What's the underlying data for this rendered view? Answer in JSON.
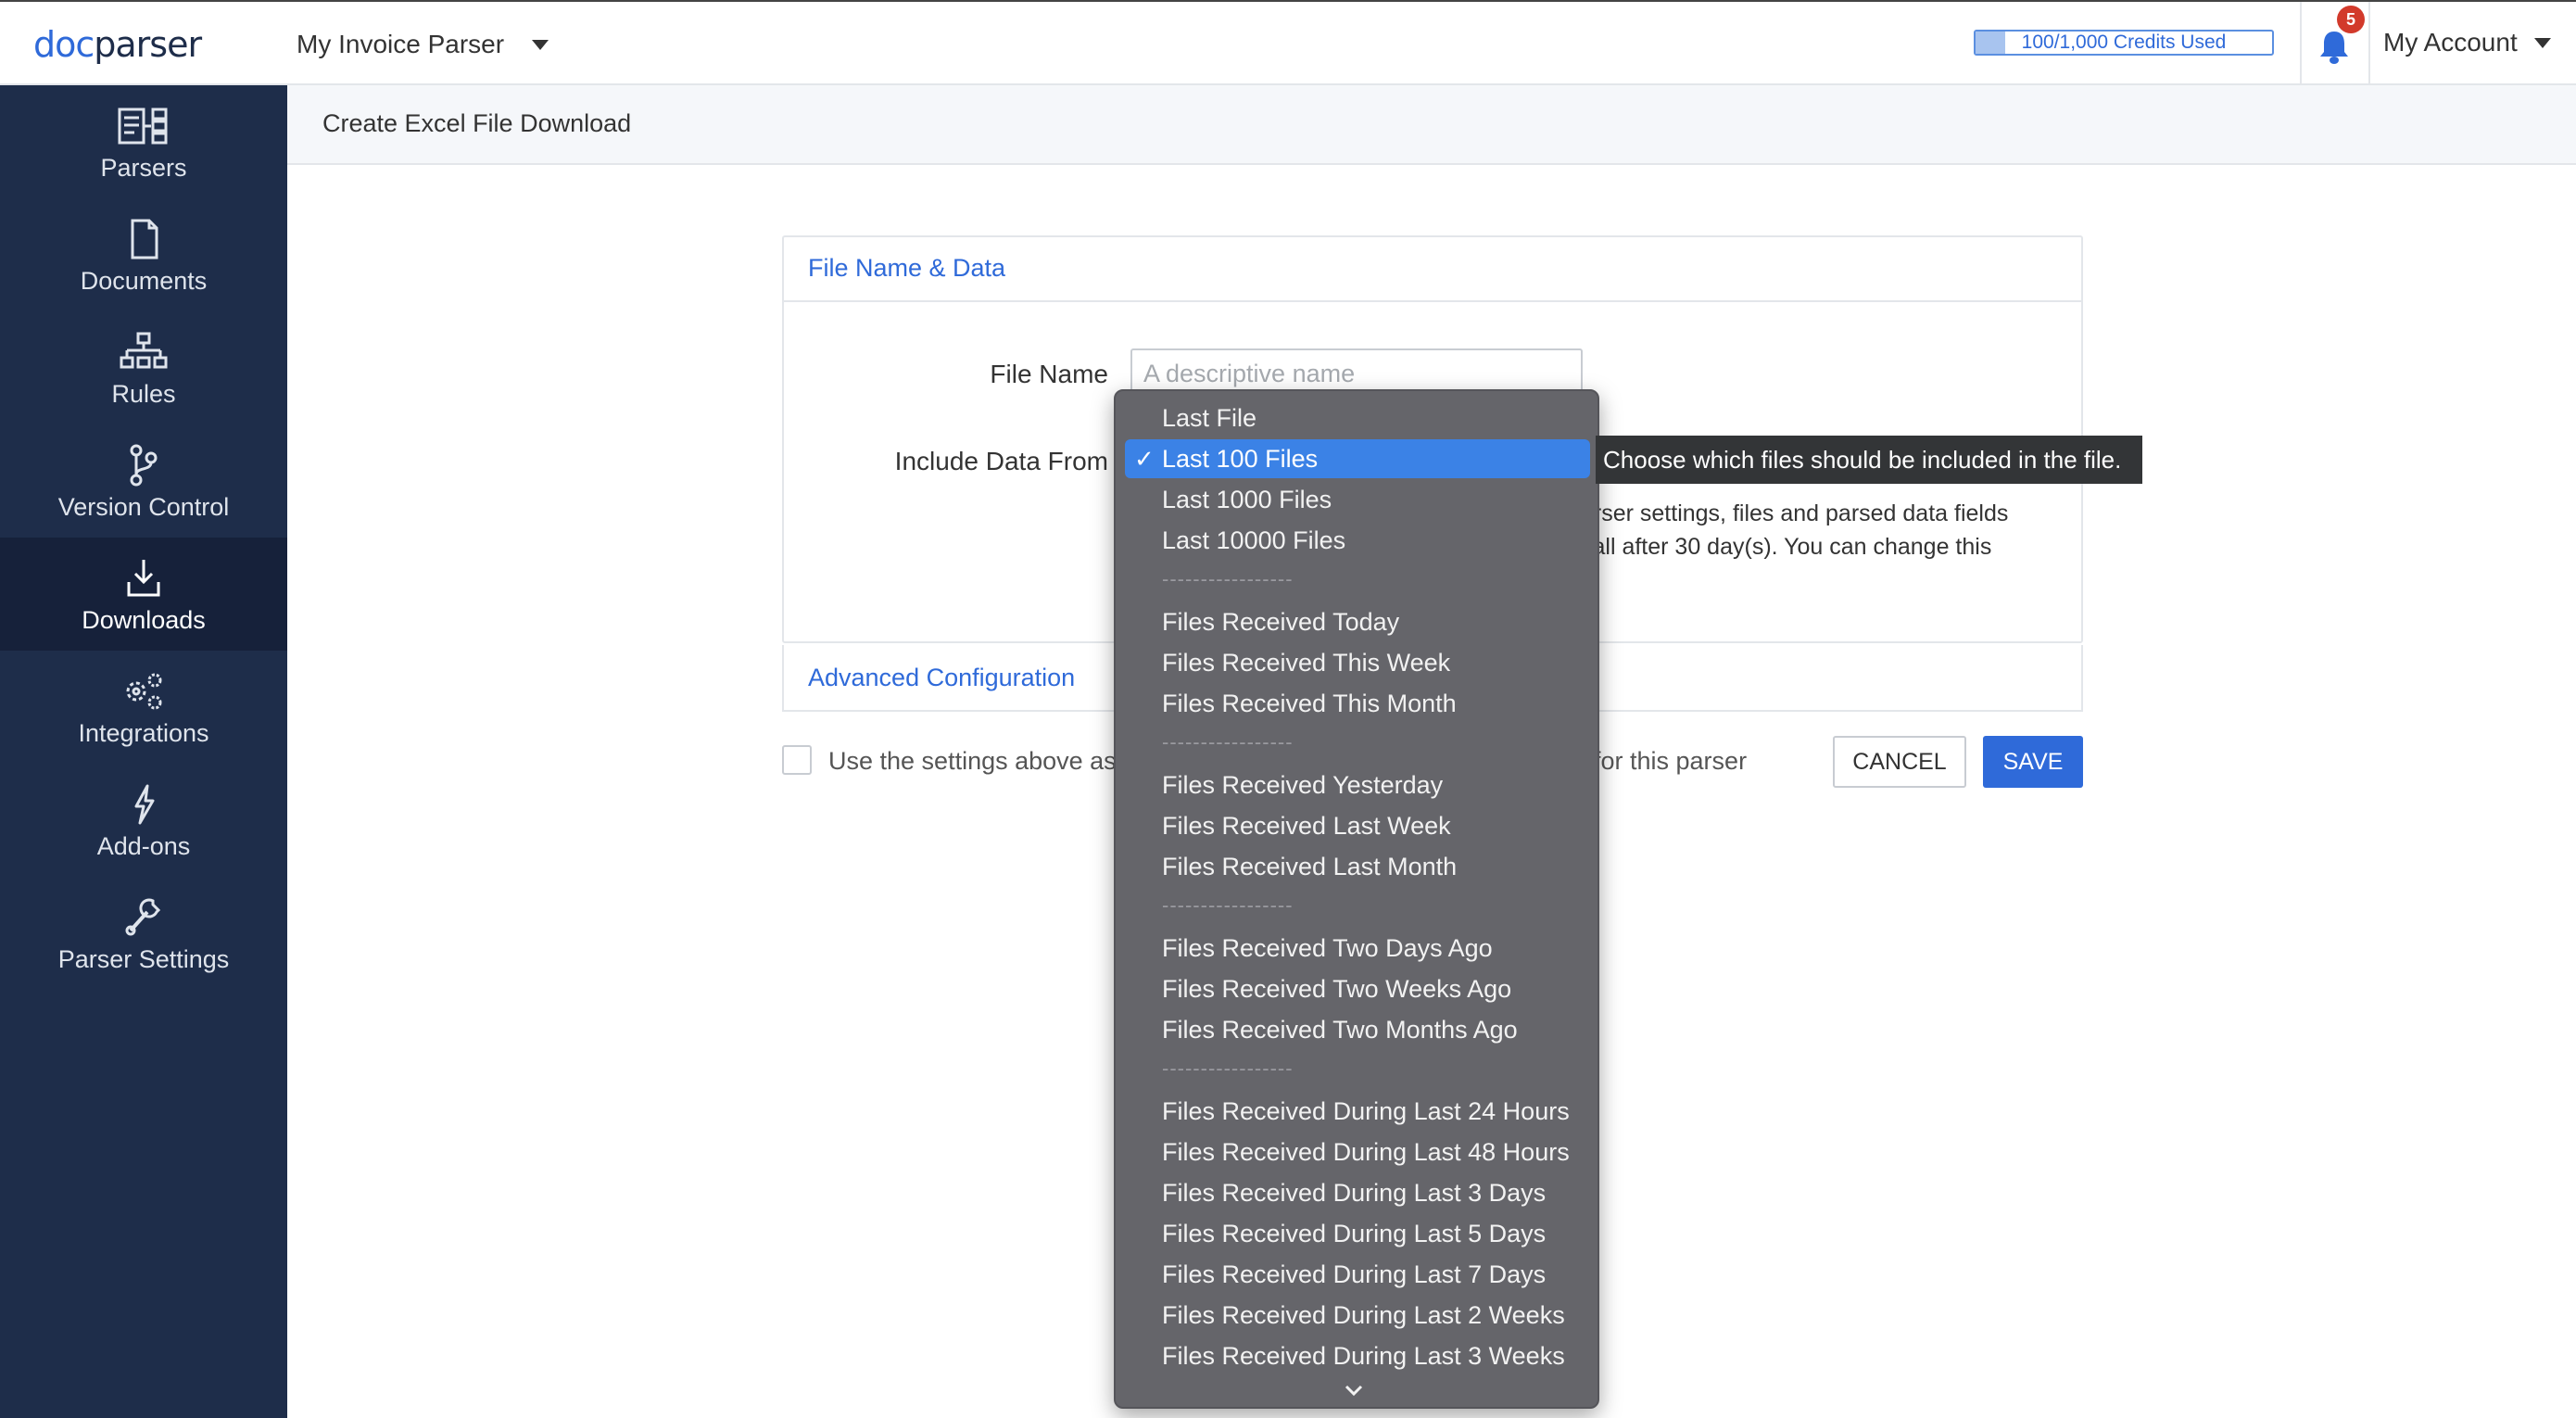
{
  "topbar": {
    "logo_prefix": "doc",
    "logo_suffix": "parser",
    "parser_name": "My Invoice Parser",
    "credits_text": "100/1,000 Credits Used",
    "credits_used_fraction": 0.1,
    "notification_count": "5",
    "account_label": "My Account"
  },
  "sidebar": {
    "items": [
      {
        "label": "Parsers",
        "icon": "parsers-icon"
      },
      {
        "label": "Documents",
        "icon": "document-icon"
      },
      {
        "label": "Rules",
        "icon": "rules-icon"
      },
      {
        "label": "Version Control",
        "icon": "version-control-icon"
      },
      {
        "label": "Downloads",
        "icon": "download-icon",
        "active": true
      },
      {
        "label": "Integrations",
        "icon": "integrations-icon"
      },
      {
        "label": "Add-ons",
        "icon": "addons-icon"
      },
      {
        "label": "Parser Settings",
        "icon": "wrench-icon"
      }
    ]
  },
  "page": {
    "breadcrumb": "Create Excel File Download"
  },
  "card": {
    "title": "File Name & Data",
    "file_name_label": "File Name",
    "file_name_placeholder": "A descriptive name",
    "file_name_value": "",
    "include_label": "Include Data From",
    "help_line1": "arser settings, files and parsed data fields",
    "help_line2": "call after 30 day(s). You can change this"
  },
  "advanced": {
    "title": "Advanced Configuration"
  },
  "footer": {
    "checkbox_label_start": "Use the settings above as",
    "checkbox_label_end": "for this parser",
    "cancel_label": "CANCEL",
    "save_label": "SAVE"
  },
  "dropdown": {
    "selected": "Last 100 Files",
    "check_glyph": "✓",
    "separator": "-----------------",
    "options": [
      "Last File",
      "Last 100 Files",
      "Last 1000 Files",
      "Last 10000 Files",
      "---",
      "Files Received Today",
      "Files Received This Week",
      "Files Received This Month",
      "---",
      "Files Received Yesterday",
      "Files Received Last Week",
      "Files Received Last Month",
      "---",
      "Files Received Two Days Ago",
      "Files Received Two Weeks Ago",
      "Files Received Two Months Ago",
      "---",
      "Files Received During Last 24 Hours",
      "Files Received During Last 48 Hours",
      "Files Received During Last 3 Days",
      "Files Received During Last 5 Days",
      "Files Received During Last 7 Days",
      "Files Received During Last 2 Weeks",
      "Files Received During Last 3 Weeks"
    ]
  },
  "tooltip": {
    "text": "Choose which files should be included in the file."
  }
}
